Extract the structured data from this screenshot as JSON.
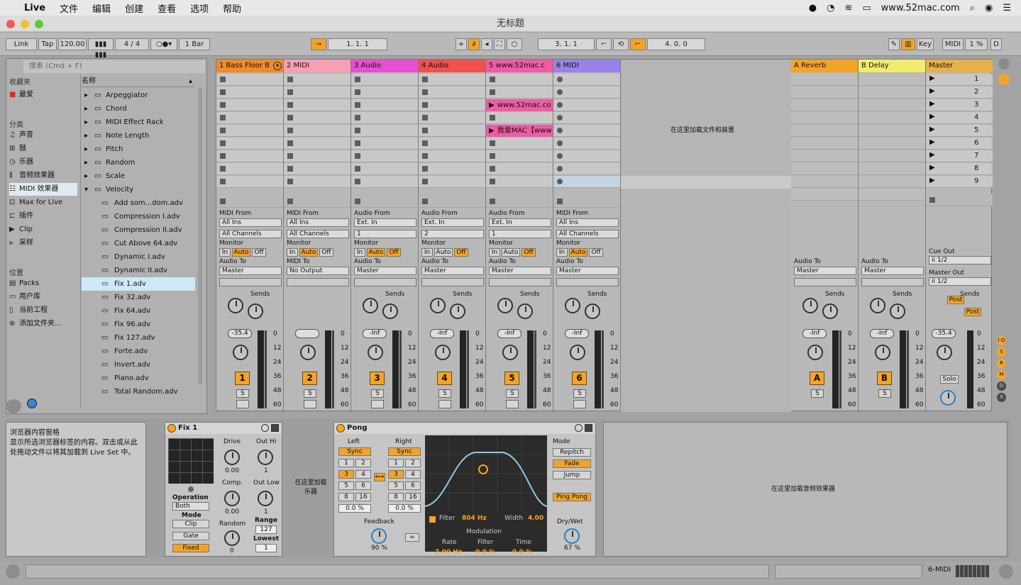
{
  "menubar": {
    "app": "Live",
    "items": [
      "文件",
      "编辑",
      "创建",
      "查看",
      "选项",
      "帮助"
    ],
    "url": "www.52mac.com"
  },
  "title": "无标题",
  "toolbar": {
    "link": "Link",
    "tap": "Tap",
    "tempo": "120.00",
    "sig_num": "4",
    "sig_den": "4",
    "quant": "1 Bar",
    "pos": "1.   1.   1",
    "loop_start": "3.   1.   1",
    "loop_len": "4.   0.   0",
    "key": "Key",
    "midi": "MIDI",
    "cpu": "1 %",
    "d": "D"
  },
  "browser": {
    "search": "搜索 (Cmd + F)",
    "collections_title": "收藏夹",
    "fav": "最爱",
    "categories_title": "分类",
    "categories": [
      {
        "label": "声音",
        "icon": "sound-icon"
      },
      {
        "label": "鼓",
        "icon": "drum-icon"
      },
      {
        "label": "乐器",
        "icon": "instrument-icon"
      },
      {
        "label": "音频效果器",
        "icon": "audio-fx-icon"
      },
      {
        "label": "MIDI 效果器",
        "icon": "midi-fx-icon"
      },
      {
        "label": "Max for Live",
        "icon": "max-icon"
      },
      {
        "label": "插件",
        "icon": "plugin-icon"
      },
      {
        "label": "Clip",
        "icon": "clip-icon"
      },
      {
        "label": "采样",
        "icon": "sample-icon"
      }
    ],
    "places_title": "位置",
    "places": [
      {
        "label": "Packs",
        "icon": "packs-icon"
      },
      {
        "label": "用户库",
        "icon": "user-library-icon"
      },
      {
        "label": "当前工程",
        "icon": "project-icon"
      },
      {
        "label": "添加文件夹...",
        "icon": "add-folder-icon"
      }
    ],
    "name_header": "名称",
    "folders": [
      "Arpeggiator",
      "Chord",
      "MIDI Effect Rack",
      "Note Length",
      "Pitch",
      "Random",
      "Scale",
      "Velocity"
    ],
    "files": [
      "Add som...dom.adv",
      "Compression I.adv",
      "Compression II.adv",
      "Cut Above 64.adv",
      "Dynamic I.adv",
      "Dynamic II.adv",
      "Fix 1.adv",
      "Fix 32.adv",
      "Fix 64.adv",
      "Fix 96.adv",
      "Fix 127.adv",
      "Forte.adv",
      "Invert.adv",
      "Piano.adv",
      "Total Random.adv"
    ]
  },
  "session": {
    "drop_text": "在这里加载文件和装置",
    "tracks": [
      {
        "name": "1 Bass Floor B",
        "color": "#f08a2a",
        "type": "midi",
        "from": "MIDI From",
        "in1": "All Ins",
        "in2": "All Channels",
        "to": "Master",
        "vol": "-35.4",
        "num": "1"
      },
      {
        "name": "2 MIDI",
        "color": "#f7a0b4",
        "type": "midi",
        "from": "MIDI From",
        "in1": "All Ins",
        "in2": "All Channels",
        "to_label": "MIDI To",
        "to": "No Output",
        "vol": "",
        "num": "2"
      },
      {
        "name": "3 Audio",
        "color": "#e84fd2",
        "type": "audio",
        "from": "Audio From",
        "in1": "Ext. In",
        "in2": "1",
        "to": "Master",
        "vol": "-Inf",
        "num": "3"
      },
      {
        "name": "4 Audio",
        "color": "#f05050",
        "type": "audio",
        "from": "Audio From",
        "in1": "Ext. In",
        "in2": "2",
        "to": "Master",
        "vol": "-Inf",
        "num": "4"
      },
      {
        "name": "5 www.52mac.c",
        "color": "#ef5ba5",
        "type": "audio",
        "from": "Audio From",
        "in1": "Ext. In",
        "in2": "1",
        "to": "Master",
        "vol": "-Inf",
        "num": "5"
      },
      {
        "name": "6 MIDI",
        "color": "#9b82e8",
        "type": "midi",
        "from": "MIDI From",
        "in1": "All Ins",
        "in2": "All Channels",
        "to": "Master",
        "vol": "-Inf",
        "num": "6"
      }
    ],
    "clips": [
      "www.52mac.co",
      "我爱MAC【www"
    ],
    "monitor": "Monitor",
    "mon_in": "In",
    "mon_auto": "Auto",
    "mon_off": "Off",
    "audio_to": "Audio To",
    "sends": "Sends",
    "solo": "S",
    "returns": [
      {
        "name": "A Reverb",
        "color": "#f3a428",
        "num": "A",
        "vol": "-Inf"
      },
      {
        "name": "B Delay",
        "color": "#f2ec6e",
        "num": "B",
        "vol": "-Inf"
      }
    ],
    "master": {
      "name": "Master",
      "color": "#e6b14a",
      "scenes": [
        "1",
        "2",
        "3",
        "4",
        "5",
        "6",
        "7",
        "8",
        "9"
      ],
      "cue_out": "Cue Out",
      "cue_val": "ii 1/2",
      "master_out": "Master Out",
      "master_val": "ii 1/2",
      "post": "Post",
      "vol": "-35.4",
      "solo": "Solo"
    },
    "scale": [
      "0",
      "12",
      "24",
      "36",
      "48",
      "60"
    ]
  },
  "info": {
    "title": "浏览器内容窗格",
    "text": "显示所选浏览器标签的内容。双击或从此处拖动文件以将其加载到 Live Set 中。"
  },
  "fix1": {
    "title": "Fix 1",
    "drive": "Drive",
    "drive_val": "0.00",
    "comp": "Comp.",
    "comp_val": "0.00",
    "random": "Random",
    "random_val": "0",
    "outhi": "Out Hi",
    "outhi_val": "1",
    "outlow": "Out Low",
    "outlow_val": "1",
    "operation": "Operation",
    "op_val": "Both",
    "mode": "Mode",
    "clip": "Clip",
    "gate": "Gate",
    "fixed": "Fixed",
    "range": "Range",
    "range_val": "127",
    "lowest": "Lowest",
    "lowest_val": "1"
  },
  "inst_drop": "在这里加载乐器",
  "pong": {
    "title": "Pong",
    "left": "Left",
    "right": "Right",
    "sync": "Sync",
    "divs": [
      "1",
      "2",
      "3",
      "4",
      "5",
      "6",
      "8",
      "16"
    ],
    "offset": "0.0 %",
    "filter_label": "Filter",
    "filter_val": "804 Hz",
    "width_label": "Width",
    "width_val": "4.00",
    "modulation": "Modulation",
    "rate": "Rate",
    "rate_val": "2.00 Hz",
    "mfilter": "Filter",
    "mfilter_val": "0.0 %",
    "time": "Time",
    "time_val": "0.0 %",
    "feedback": "Feedback",
    "fb_val": "90 %",
    "mode": "Mode",
    "repitch": "Repitch",
    "fade": "Fade",
    "jump": "Jump",
    "pingpong": "Ping Pong",
    "drywet": "Dry/Wet",
    "dw_val": "67 %"
  },
  "fx_drop": "在这里加载音频效果器",
  "status": {
    "track": "6-MIDI"
  },
  "indicators": [
    "I·O",
    "S",
    "R",
    "M",
    "D",
    "X"
  ]
}
